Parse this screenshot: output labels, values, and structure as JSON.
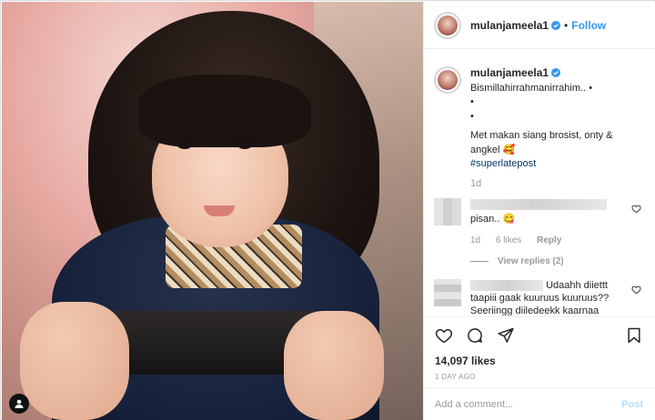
{
  "header": {
    "username": "mulanjameela1",
    "separator": "•",
    "follow_label": "Follow"
  },
  "caption": {
    "username": "mulanjameela1",
    "line1": "Bismillahirrahmanirrahim.. •",
    "line2": "•",
    "line3": "•",
    "line4": "Met makan siang brosist, onty & angkel 🥰",
    "hashtag": "#superlatepost",
    "time": "1d"
  },
  "comments": [
    {
      "text": "pisan.. 😋",
      "time": "1d",
      "likes": "6 likes",
      "reply_label": "Reply",
      "view_replies": "View replies (2)"
    },
    {
      "text": "Udaahh diiettt taapiii gaak kuuruus kuuruus?? Seeriingg diiledeekk kaarnaa baadaan geemuukk?? Kaamii"
    }
  ],
  "actions": {
    "likes": "14,097 likes",
    "time_ago": "1 DAY AGO"
  },
  "comment_box": {
    "placeholder": "Add a comment...",
    "post_label": "Post"
  },
  "colors": {
    "accent": "#3897f0",
    "hashtag": "#003569",
    "post_disabled": "#b2dffc",
    "muted": "#999999"
  },
  "icons": [
    "user-icon",
    "verified-icon",
    "heart-icon",
    "comment-icon",
    "share-icon",
    "bookmark-icon"
  ]
}
